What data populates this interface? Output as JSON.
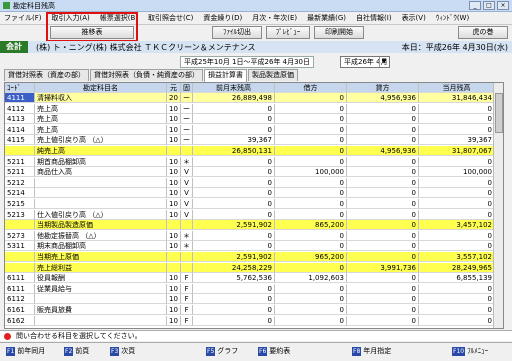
{
  "window": {
    "title": "勘定科目残高"
  },
  "menu": [
    "ファイル(F)",
    "取引入力(A)",
    "帳票選択(B)",
    "取引照会せ(C)",
    "資金繰り(D)",
    "月次・年次(E)",
    "最新業績(G)",
    "自社情報(I)",
    "表示(V)",
    "ｳｨﾝﾄﾞｳ(W)"
  ],
  "toolbar": {
    "suii": "推移表",
    "file_out": "ﾌｧｲﾙ切出",
    "preview": "ﾌﾟﾚﾋﾞｭｰ",
    "print": "印刷開始",
    "tora": "虎の巻"
  },
  "header": {
    "kaikei": "会計",
    "company": "(株) ト・ニング(株)  株式会社  ＴＫＣクリーン＆メンテナンス",
    "today": "本日：平成26年 4月30日(水)"
  },
  "period": {
    "range": "平成25年10月 1日～平成26年 4月30日",
    "month": "平成26年 4月"
  },
  "tabs": [
    "貸借対照表（資産の部）",
    "貸借対照表（負債・純資産の部）",
    "損益計算書",
    "製品製造原価"
  ],
  "columns": [
    "ｺｰﾄﾞ",
    "勘定科目名",
    "元",
    "固",
    "前月末残高",
    "借方",
    "貸方",
    "当月残高"
  ],
  "rows": [
    {
      "type": "sel",
      "code": "4111",
      "name": "清掃料収入",
      "g": "20",
      "k": "ー",
      "prev": "26,889,498",
      "debit": "0",
      "credit": "4,956,936",
      "cur": "31,846,434"
    },
    {
      "type": "n",
      "code": "4112",
      "name": "売上高",
      "g": "10",
      "k": "ー",
      "prev": "0",
      "debit": "0",
      "credit": "0",
      "cur": "0"
    },
    {
      "type": "n",
      "code": "4113",
      "name": "売上高",
      "g": "10",
      "k": "ー",
      "prev": "0",
      "debit": "0",
      "credit": "0",
      "cur": "0"
    },
    {
      "type": "n",
      "code": "4114",
      "name": "売上高",
      "g": "10",
      "k": "ー",
      "prev": "0",
      "debit": "0",
      "credit": "0",
      "cur": "0"
    },
    {
      "type": "n",
      "code": "4115",
      "name": "売上値引戻り高 （△）",
      "g": "10",
      "k": "ー",
      "prev": "39,367",
      "debit": "0",
      "credit": "0",
      "cur": "39,367"
    },
    {
      "type": "y",
      "code": "",
      "name": "純売上高",
      "g": "",
      "k": "",
      "prev": "26,850,131",
      "debit": "0",
      "credit": "4,956,936",
      "cur": "31,807,067"
    },
    {
      "type": "n",
      "code": "5211",
      "name": "期首商品棚卸高",
      "g": "10",
      "k": "＊",
      "prev": "0",
      "debit": "0",
      "credit": "0",
      "cur": "0"
    },
    {
      "type": "n",
      "code": "5211",
      "name": "商品仕入高",
      "g": "10",
      "k": "V",
      "prev": "0",
      "debit": "100,000",
      "credit": "0",
      "cur": "100,000"
    },
    {
      "type": "n",
      "code": "5212",
      "name": "",
      "g": "10",
      "k": "V",
      "prev": "0",
      "debit": "0",
      "credit": "0",
      "cur": "0"
    },
    {
      "type": "n",
      "code": "5214",
      "name": "",
      "g": "10",
      "k": "V",
      "prev": "0",
      "debit": "0",
      "credit": "0",
      "cur": "0"
    },
    {
      "type": "n",
      "code": "5215",
      "name": "",
      "g": "10",
      "k": "V",
      "prev": "0",
      "debit": "0",
      "credit": "0",
      "cur": "0"
    },
    {
      "type": "n",
      "code": "5213",
      "name": "仕入値引戻り高 （△）",
      "g": "10",
      "k": "V",
      "prev": "0",
      "debit": "0",
      "credit": "0",
      "cur": "0"
    },
    {
      "type": "y",
      "code": "",
      "name": "当期製品製造原価",
      "g": "",
      "k": "",
      "prev": "2,591,902",
      "debit": "865,200",
      "credit": "0",
      "cur": "3,457,102"
    },
    {
      "type": "n",
      "code": "5273",
      "name": "他勘定振替高 （△）",
      "g": "10",
      "k": "＊",
      "prev": "0",
      "debit": "0",
      "credit": "0",
      "cur": "0"
    },
    {
      "type": "n",
      "code": "5311",
      "name": "期末商品棚卸高",
      "g": "10",
      "k": "＊",
      "prev": "0",
      "debit": "0",
      "credit": "0",
      "cur": "0"
    },
    {
      "type": "y",
      "code": "",
      "name": "当期売上原価",
      "g": "",
      "k": "",
      "prev": "2,591,902",
      "debit": "965,200",
      "credit": "0",
      "cur": "3,557,102"
    },
    {
      "type": "y",
      "code": "",
      "name": "売上総利益",
      "g": "",
      "k": "",
      "prev": "24,258,229",
      "debit": "0",
      "credit": "3,991,736",
      "cur": "28,249,965"
    },
    {
      "type": "n",
      "code": "6111",
      "name": "役員報酬",
      "g": "10",
      "k": "F",
      "prev": "5,762,536",
      "debit": "1,092,603",
      "credit": "0",
      "cur": "6,855,139"
    },
    {
      "type": "n",
      "code": "6111",
      "name": "従業員給与",
      "g": "10",
      "k": "F",
      "prev": "0",
      "debit": "0",
      "credit": "0",
      "cur": "0"
    },
    {
      "type": "n",
      "code": "6112",
      "name": "",
      "g": "10",
      "k": "F",
      "prev": "0",
      "debit": "0",
      "credit": "0",
      "cur": "0"
    },
    {
      "type": "n",
      "code": "6161",
      "name": "販売員旅費",
      "g": "10",
      "k": "F",
      "prev": "0",
      "debit": "0",
      "credit": "0",
      "cur": "0"
    },
    {
      "type": "n",
      "code": "6162",
      "name": "",
      "g": "10",
      "k": "F",
      "prev": "0",
      "debit": "0",
      "credit": "0",
      "cur": "0"
    }
  ],
  "hint": "問い合わせる科目を選択してください。",
  "fkeys": [
    {
      "k": "F1",
      "label": "前年同月"
    },
    {
      "k": "F2",
      "label": "前頁"
    },
    {
      "k": "F3",
      "label": "次頁"
    },
    {
      "k": "F5",
      "label": "グラフ"
    },
    {
      "k": "F6",
      "label": "要約表"
    },
    {
      "k": "F8",
      "label": "年月指定"
    },
    {
      "k": "F10",
      "label": "ﾌﾙﾒﾆｭｰ"
    }
  ]
}
